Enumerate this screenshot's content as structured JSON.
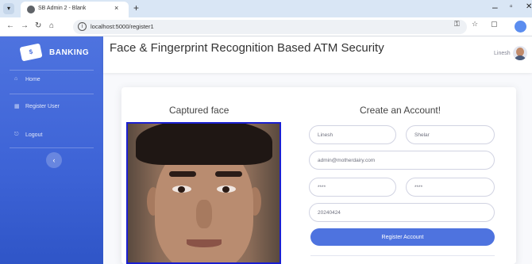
{
  "browser": {
    "tab_title": "SB Admin 2 - Blank",
    "url": "localhost:5000/register1",
    "tab_close": "×",
    "new_tab": "+",
    "win_min": "–",
    "win_restore": "▫",
    "win_close": "✕"
  },
  "sidebar": {
    "brand_logo": "$",
    "brand": "BANKING",
    "items": [
      {
        "label": "Home",
        "icon": "home-icon"
      },
      {
        "label": "Register User",
        "icon": "table-icon"
      },
      {
        "label": "Logout",
        "icon": "logout-icon"
      }
    ],
    "collapse_glyph": "‹"
  },
  "topbar": {
    "title": "Face & Fingerprint Recognition Based ATM Security",
    "user_name": "Linesh"
  },
  "card": {
    "captured_title": "Captured face",
    "form_title": "Create an Account!",
    "first_name": "Linesh",
    "last_name": "Shelar",
    "email": "admin@motherdairy.com",
    "password": "****",
    "repeat_password": "****",
    "dob": "20240424",
    "submit_label": "Register Account"
  },
  "colors": {
    "primary": "#4e73df",
    "face_border": "#1a1fd0"
  }
}
